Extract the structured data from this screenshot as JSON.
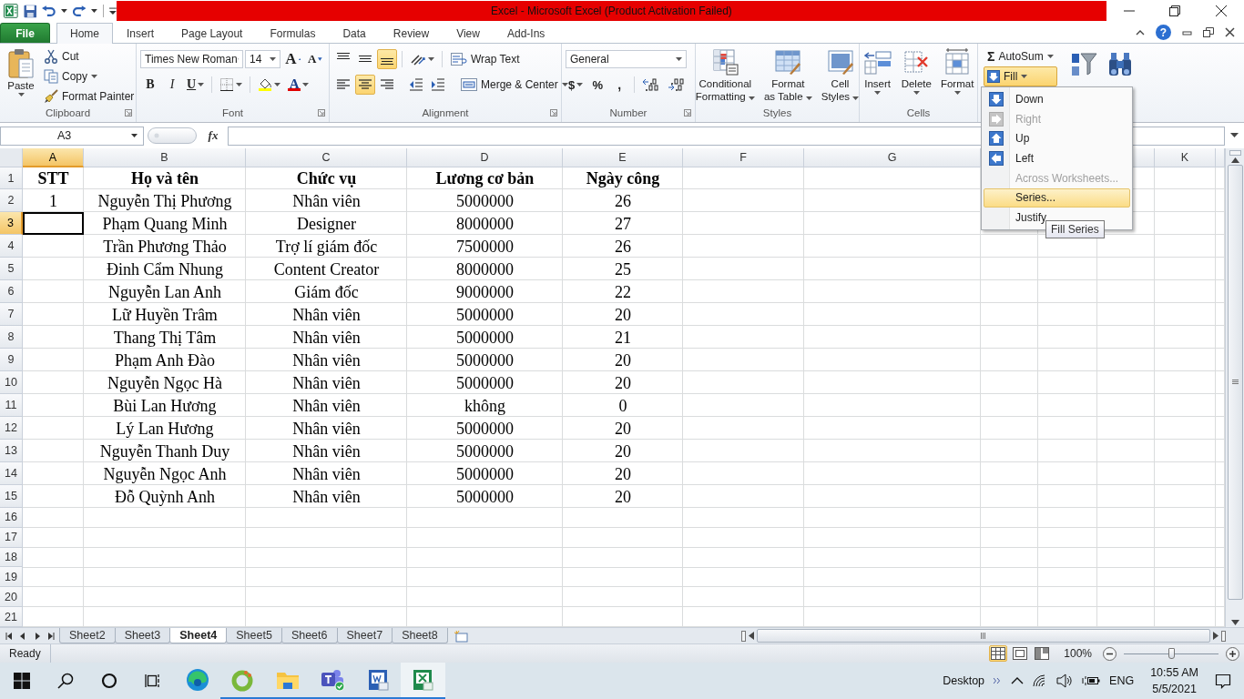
{
  "window": {
    "title": "Excel  -  Microsoft Excel (Product Activation Failed)"
  },
  "ribbon_tabs": [
    {
      "label": "File",
      "kind": "file",
      "selected": false
    },
    {
      "label": "Home",
      "kind": "tab",
      "selected": true
    },
    {
      "label": "Insert",
      "kind": "tab",
      "selected": false
    },
    {
      "label": "Page Layout",
      "kind": "tab",
      "selected": false
    },
    {
      "label": "Formulas",
      "kind": "tab",
      "selected": false
    },
    {
      "label": "Data",
      "kind": "tab",
      "selected": false
    },
    {
      "label": "Review",
      "kind": "tab",
      "selected": false
    },
    {
      "label": "View",
      "kind": "tab",
      "selected": false
    },
    {
      "label": "Add-Ins",
      "kind": "tab",
      "selected": false
    }
  ],
  "help": "?",
  "ribbon": {
    "clipboard": {
      "label": "Clipboard",
      "paste": "Paste",
      "cut": "Cut",
      "copy": "Copy",
      "format_painter": "Format Painter"
    },
    "font": {
      "label": "Font",
      "font_name": "Times New Roman",
      "font_size": "14",
      "grow": "A",
      "shrink": "A",
      "font_color": "A",
      "styles": [
        {
          "kind": "bold",
          "label": "B"
        },
        {
          "kind": "italic",
          "label": "I"
        },
        {
          "kind": "underline",
          "label": "U"
        }
      ]
    },
    "alignment": {
      "label": "Alignment",
      "wrap_text": "Wrap Text",
      "merge": "Merge & Center",
      "vertical": [
        {
          "kind": "top",
          "selected": false
        },
        {
          "kind": "middle",
          "selected": false
        },
        {
          "kind": "bottom",
          "selected": true
        }
      ],
      "horizontal": [
        {
          "kind": "left",
          "selected": false
        },
        {
          "kind": "center",
          "selected": true
        },
        {
          "kind": "right",
          "selected": false
        }
      ]
    },
    "number": {
      "label": "Number",
      "format": "General",
      "currency": "$",
      "percent": "%",
      "comma": ","
    },
    "styles": {
      "label": "Styles",
      "buttons": [
        {
          "kind": "conditional",
          "lines": [
            "Conditional",
            "Formatting"
          ]
        },
        {
          "kind": "table",
          "lines": [
            "Format",
            "as Table"
          ]
        },
        {
          "kind": "cell",
          "lines": [
            "Cell",
            "Styles"
          ]
        }
      ]
    },
    "cells": {
      "label": "Cells",
      "buttons": [
        {
          "kind": "insert",
          "label": "Insert"
        },
        {
          "kind": "delete",
          "label": "Delete"
        },
        {
          "kind": "format",
          "label": "Format"
        }
      ]
    },
    "editing": {
      "autosum": {
        "symbol": "Σ",
        "label": "AutoSum"
      },
      "fill": {
        "label": "Fill",
        "expanded": true
      }
    }
  },
  "formula_bar": {
    "name_box": "A3",
    "function_label": "fx"
  },
  "sheet": {
    "columns": [
      {
        "label": "A",
        "selected": true
      },
      {
        "label": "B",
        "selected": false
      },
      {
        "label": "C",
        "selected": false
      },
      {
        "label": "D",
        "selected": false
      },
      {
        "label": "E",
        "selected": false
      },
      {
        "label": "F",
        "selected": false
      },
      {
        "label": "G",
        "selected": false
      },
      {},
      {},
      {
        "selected": false
      },
      {
        "label": "K",
        "selected": false
      }
    ],
    "rows": [
      {
        "header": "1",
        "kind": "header",
        "selected": false,
        "cells": [
          "STT",
          "Họ và tên",
          "Chức vụ",
          "Lương cơ bản",
          "Ngày công"
        ]
      },
      {
        "header": "2",
        "kind": "data",
        "selected": false,
        "cells": [
          "1",
          "Nguyễn Thị Phương",
          "Nhân viên",
          "5000000",
          "26"
        ]
      },
      {
        "header": "3",
        "kind": "data",
        "selected": true,
        "cells": [
          null,
          "Phạm Quang Minh",
          "Designer",
          "8000000",
          "27"
        ]
      },
      {
        "header": "4",
        "kind": "data",
        "selected": false,
        "cells": [
          null,
          "Trần Phương Thảo",
          "Trợ lí giám đốc",
          "7500000",
          "26"
        ]
      },
      {
        "header": "5",
        "kind": "data",
        "selected": false,
        "cells": [
          null,
          "Đinh Cẩm Nhung",
          "Content Creator",
          "8000000",
          "25"
        ]
      },
      {
        "header": "6",
        "kind": "data",
        "selected": false,
        "cells": [
          null,
          "Nguyễn Lan Anh",
          "Giám đốc",
          "9000000",
          "22"
        ]
      },
      {
        "header": "7",
        "kind": "data",
        "selected": false,
        "cells": [
          null,
          "Lữ Huyền Trâm",
          "Nhân viên",
          "5000000",
          "20"
        ]
      },
      {
        "header": "8",
        "kind": "data",
        "selected": false,
        "cells": [
          null,
          "Thang Thị Tâm",
          "Nhân viên",
          "5000000",
          "21"
        ]
      },
      {
        "header": "9",
        "kind": "data",
        "selected": false,
        "cells": [
          null,
          "Phạm Anh Đào",
          "Nhân viên",
          "5000000",
          "20"
        ]
      },
      {
        "header": "10",
        "kind": "data",
        "selected": false,
        "cells": [
          null,
          "Nguyễn Ngọc Hà",
          "Nhân viên",
          "5000000",
          "20"
        ]
      },
      {
        "header": "11",
        "kind": "data",
        "selected": false,
        "cells": [
          null,
          "Bùi Lan Hương",
          "Nhân viên",
          "không",
          "0"
        ]
      },
      {
        "header": "12",
        "kind": "data",
        "selected": false,
        "cells": [
          null,
          "Lý Lan Hương",
          "Nhân viên",
          "5000000",
          "20"
        ]
      },
      {
        "header": "13",
        "kind": "data",
        "selected": false,
        "cells": [
          null,
          "Nguyễn Thanh Duy",
          "Nhân viên",
          "5000000",
          "20"
        ]
      },
      {
        "header": "14",
        "kind": "data",
        "selected": false,
        "cells": [
          null,
          "Nguyễn Ngọc Anh",
          "Nhân viên",
          "5000000",
          "20"
        ]
      },
      {
        "header": "15",
        "kind": "data",
        "selected": false,
        "cells": [
          null,
          "Đỗ Quỳnh Anh",
          "Nhân viên",
          "5000000",
          "20"
        ]
      },
      {
        "header": "16",
        "kind": "empty",
        "selected": false
      },
      {
        "header": "17",
        "kind": "empty",
        "selected": false
      },
      {
        "header": "18",
        "kind": "empty",
        "selected": false
      },
      {
        "header": "19",
        "kind": "empty",
        "selected": false
      },
      {
        "header": "20",
        "kind": "empty",
        "selected": false
      },
      {
        "header": "21",
        "kind": "empty",
        "selected": false
      }
    ]
  },
  "fill_menu": {
    "items": [
      {
        "label": "Down",
        "kind": "down",
        "disabled": false,
        "selected": false
      },
      {
        "label": "Right",
        "kind": "right",
        "disabled": true,
        "selected": false
      },
      {
        "label": "Up",
        "kind": "up",
        "disabled": false,
        "selected": false
      },
      {
        "label": "Left",
        "kind": "left",
        "disabled": false,
        "selected": false
      },
      {
        "label": "Across Worksheets...",
        "kind": "plain",
        "disabled": true,
        "selected": false
      },
      {
        "label": "Series...",
        "kind": "plain",
        "disabled": false,
        "selected": true
      },
      {
        "label": "Justify",
        "kind": "plain",
        "disabled": false,
        "selected": false
      }
    ],
    "tooltip": "Fill Series"
  },
  "sheet_tabs": [
    {
      "label": "Sheet2",
      "selected": false
    },
    {
      "label": "Sheet3",
      "selected": false
    },
    {
      "label": "Sheet4",
      "selected": true
    },
    {
      "label": "Sheet5",
      "selected": false
    },
    {
      "label": "Sheet6",
      "selected": false
    },
    {
      "label": "Sheet7",
      "selected": false
    },
    {
      "label": "Sheet8",
      "selected": false
    }
  ],
  "status_bar": {
    "status": "Ready",
    "views": [
      {
        "kind": "normal",
        "selected": true
      },
      {
        "kind": "page_layout",
        "selected": false
      },
      {
        "kind": "page_break",
        "selected": false
      }
    ],
    "zoom": "100%",
    "zoom_slider": {
      "level": 0.5
    }
  },
  "taskbar": {
    "apps": [
      {
        "kind": "edge",
        "running": false,
        "selected": false
      },
      {
        "kind": "coccoc",
        "running": true,
        "selected": false
      },
      {
        "kind": "files",
        "running": true,
        "selected": false
      },
      {
        "kind": "teams",
        "running": true,
        "selected": false
      },
      {
        "kind": "word",
        "running": true,
        "selected": false
      },
      {
        "kind": "excel",
        "running": true,
        "selected": true
      }
    ],
    "desktop": "Desktop",
    "language": "ENG",
    "time": "10:55 AM",
    "date": "5/5/2021"
  }
}
